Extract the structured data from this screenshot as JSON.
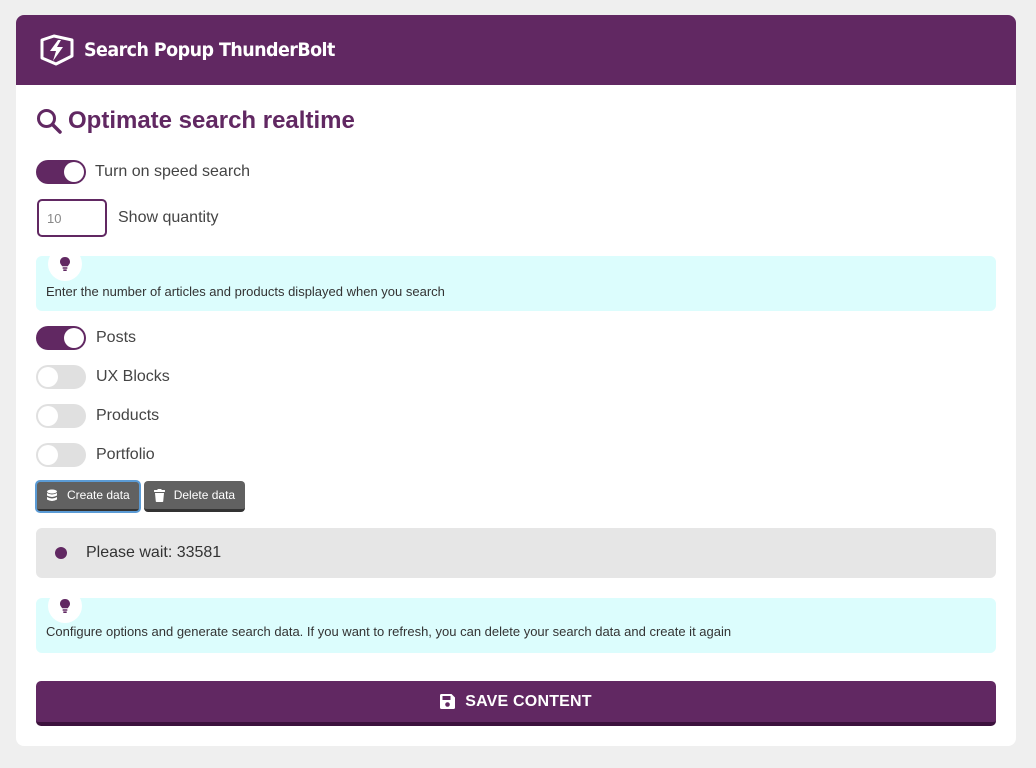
{
  "header": {
    "app_title": "Search Popup ThunderBolt",
    "logo_icon": "lightning-bolt-logo-icon"
  },
  "main": {
    "title": "Optimate search realtime",
    "title_icon": "search-icon",
    "speed_search": {
      "label": "Turn on speed search",
      "enabled": true
    },
    "quantity": {
      "value": "10",
      "label": "Show quantity"
    },
    "tip1": "Enter the number of articles and products displayed when you search",
    "post_types": [
      {
        "label": "Posts",
        "enabled": true
      },
      {
        "label": "UX Blocks",
        "enabled": false
      },
      {
        "label": "Products",
        "enabled": false
      },
      {
        "label": "Portfolio",
        "enabled": false
      }
    ],
    "buttons": {
      "create_label": "Create data",
      "delete_label": "Delete data"
    },
    "status_text": "Please wait: 33581",
    "tip2": "Configure options and generate search data. If you want to refresh, you can delete your search data and create it again",
    "save_label": "SAVE CONTENT"
  },
  "colors": {
    "brand": "#612862",
    "tip_bg": "#dcfdfd",
    "toggle_off": "#e0e0e0",
    "button_gray": "#616161"
  }
}
